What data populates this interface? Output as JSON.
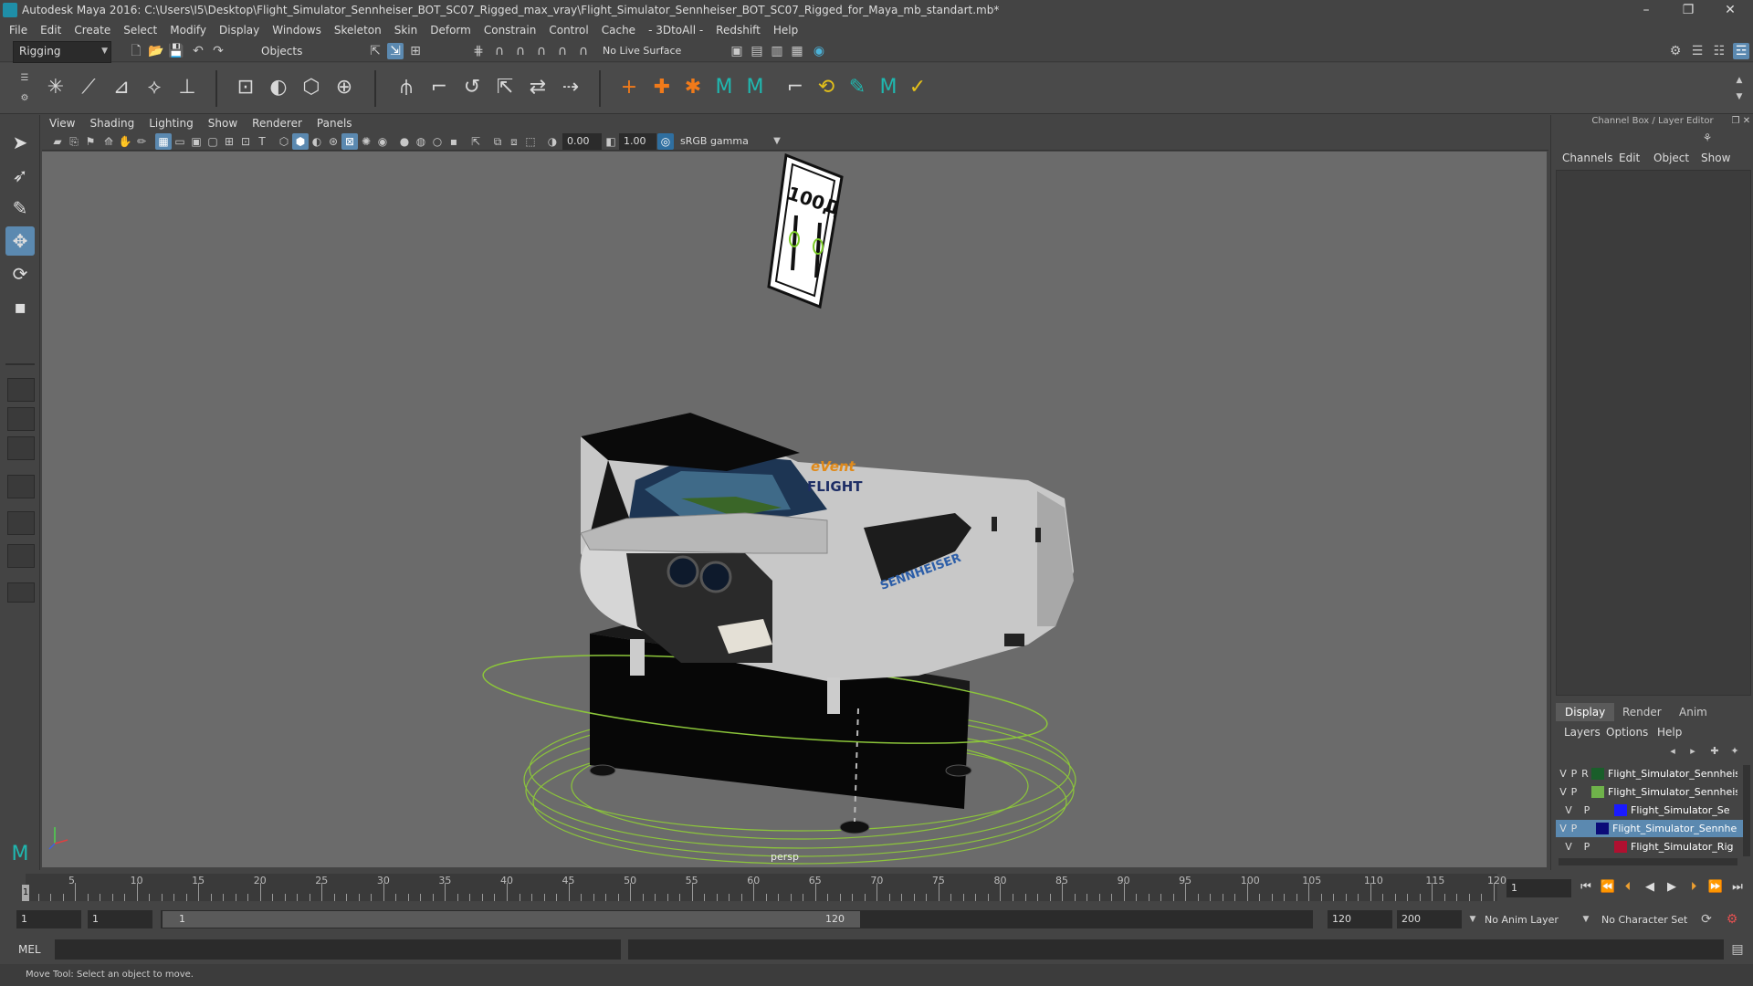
{
  "window": {
    "title": "Autodesk Maya 2016: C:\\Users\\I5\\Desktop\\Flight_Simulator_Sennheiser_BOT_SC07_Rigged_max_vray\\Flight_Simulator_Sennheiser_BOT_SC07_Rigged_for_Maya_mb_standart.mb*",
    "minimize": "–",
    "restore": "❐",
    "close": "✕"
  },
  "menubar": [
    "File",
    "Edit",
    "Create",
    "Select",
    "Modify",
    "Display",
    "Windows",
    "Skeleton",
    "Skin",
    "Deform",
    "Constrain",
    "Control",
    "Cache",
    "- 3DtoAll -",
    "Redshift",
    "Help"
  ],
  "statusline": {
    "menuset": "Rigging",
    "selection_mode": "Objects",
    "live_surface": "No Live Surface"
  },
  "panel": {
    "menus": [
      "View",
      "Shading",
      "Lighting",
      "Show",
      "Renderer",
      "Panels"
    ],
    "exposure": "0.00",
    "gamma": "1.00",
    "colorspace": "sRGB gamma",
    "camera": "persp"
  },
  "overlay": {
    "sign_text": "100Д"
  },
  "model_labels": {
    "brand_top": "eVent",
    "brand_bottom": "FLIGHT",
    "side": "SENNHEISER"
  },
  "channelbox": {
    "header": "Channel Box / Layer Editor",
    "tabs": [
      "Channels",
      "Edit",
      "Object",
      "Show"
    ]
  },
  "layer_editor": {
    "tabs": [
      "Display",
      "Render",
      "Anim"
    ],
    "menus": [
      "Layers",
      "Options",
      "Help"
    ],
    "layers": [
      {
        "v": "V",
        "p": "P",
        "r": "R",
        "color": "#1a5e2a",
        "name": "Flight_Simulator_Sennheis",
        "selected": false
      },
      {
        "v": "V",
        "p": "P",
        "r": "",
        "color": "#6fb24a",
        "name": "Flight_Simulator_Sennheis",
        "selected": false
      },
      {
        "v": "V",
        "p": "P",
        "r": "",
        "color": "#1a1aff",
        "name": "Flight_Simulator_Se",
        "selected": false
      },
      {
        "v": "V",
        "p": "P",
        "r": "",
        "color": "#0b0b78",
        "name": "Flight_Simulator_Sennhe",
        "selected": true
      },
      {
        "v": "V",
        "p": "P",
        "r": "",
        "color": "#b01030",
        "name": "Flight_Simulator_Rig",
        "selected": false
      }
    ]
  },
  "timeline": {
    "start": 1,
    "end": 120,
    "step": 5,
    "current_frame": "1",
    "current_marker": "1"
  },
  "range": {
    "start": "1",
    "anim_start": "1",
    "slider_start": "1",
    "slider_end": "120",
    "range_end": "120",
    "anim_end": "200",
    "anim_layer": "No Anim Layer",
    "character_set": "No Character Set"
  },
  "cmdline": {
    "lang": "MEL"
  },
  "helpline": {
    "text": "Move Tool: Select an object to move."
  }
}
